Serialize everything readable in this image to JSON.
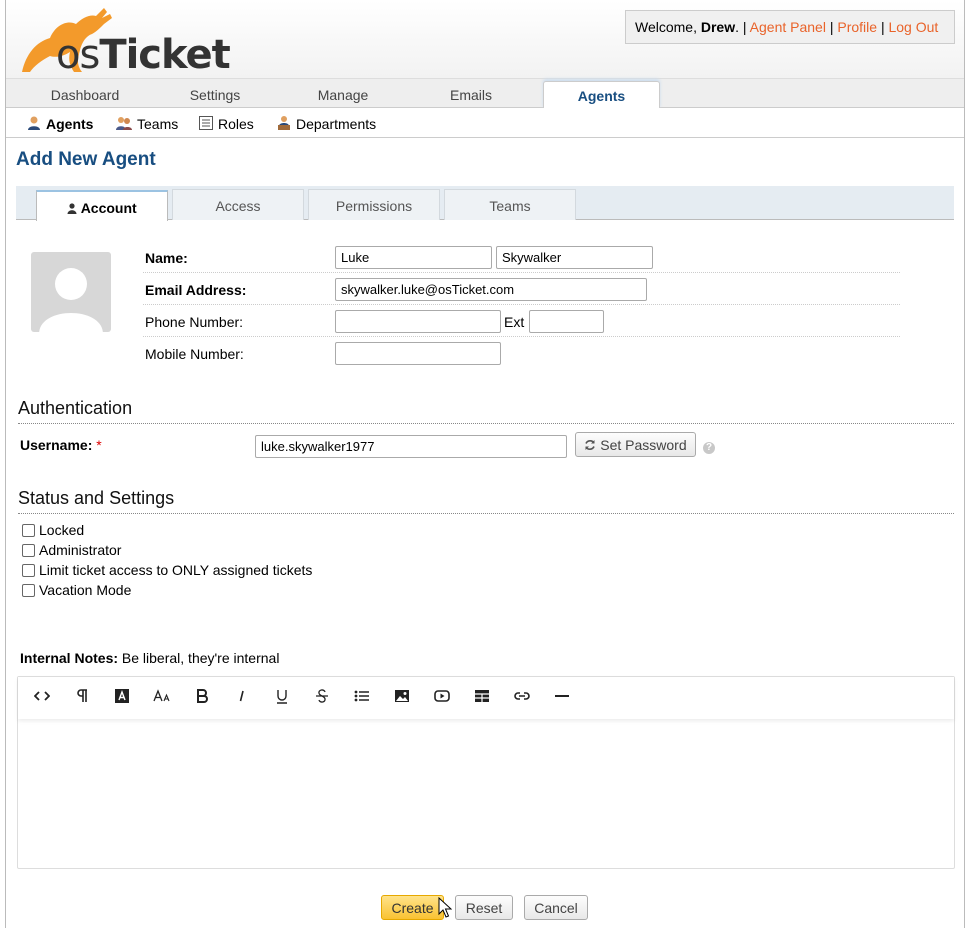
{
  "brand": {
    "logo_text_os": "os",
    "logo_text_ticket": "Ticket"
  },
  "header": {
    "welcome_prefix": "Welcome, ",
    "user_name": "Drew",
    "separator": ". | ",
    "pipe": " | ",
    "agent_panel": "Agent Panel",
    "profile": "Profile",
    "logout": "Log Out"
  },
  "topnav": {
    "tabs": [
      "Dashboard",
      "Settings",
      "Manage",
      "Emails",
      "Agents"
    ],
    "active": "Agents"
  },
  "subnav": {
    "items": [
      "Agents",
      "Teams",
      "Roles",
      "Departments"
    ],
    "active": "Agents"
  },
  "page": {
    "title": "Add New Agent"
  },
  "form_tabs": {
    "items": [
      "Account",
      "Access",
      "Permissions",
      "Teams"
    ],
    "active": "Account"
  },
  "account": {
    "name_label": "Name:",
    "first_name": "Luke",
    "last_name": "Skywalker",
    "email_label": "Email Address:",
    "email": "skywalker.luke@osTicket.com",
    "phone_label": "Phone Number:",
    "phone": "",
    "ext_label": "Ext",
    "ext": "",
    "mobile_label": "Mobile Number:",
    "mobile": ""
  },
  "authentication": {
    "heading": "Authentication",
    "username_label": "Username:",
    "required_mark": "*",
    "username": "luke.skywalker1977",
    "set_password": "Set Password",
    "help": "?"
  },
  "status": {
    "heading": "Status and Settings",
    "options": [
      {
        "label": "Locked",
        "checked": false
      },
      {
        "label": "Administrator",
        "checked": false
      },
      {
        "label": "Limit ticket access to ONLY assigned tickets",
        "checked": false
      },
      {
        "label": "Vacation Mode",
        "checked": false
      }
    ]
  },
  "notes": {
    "label": "Internal Notes:",
    "hint": " Be liberal, they're internal",
    "toolbar": [
      "code-icon",
      "paragraph-icon",
      "text-color-icon",
      "font-size-icon",
      "bold-icon",
      "italic-icon",
      "underline-icon",
      "strikethrough-icon",
      "list-icon",
      "image-icon",
      "video-icon",
      "table-icon",
      "link-icon",
      "horizontal-rule-icon"
    ]
  },
  "actions": {
    "create": "Create",
    "reset": "Reset",
    "cancel": "Cancel"
  },
  "colors": {
    "brand_orange": "#e9632a",
    "title_blue": "#184e81",
    "create_yellow": "#f9c232"
  }
}
